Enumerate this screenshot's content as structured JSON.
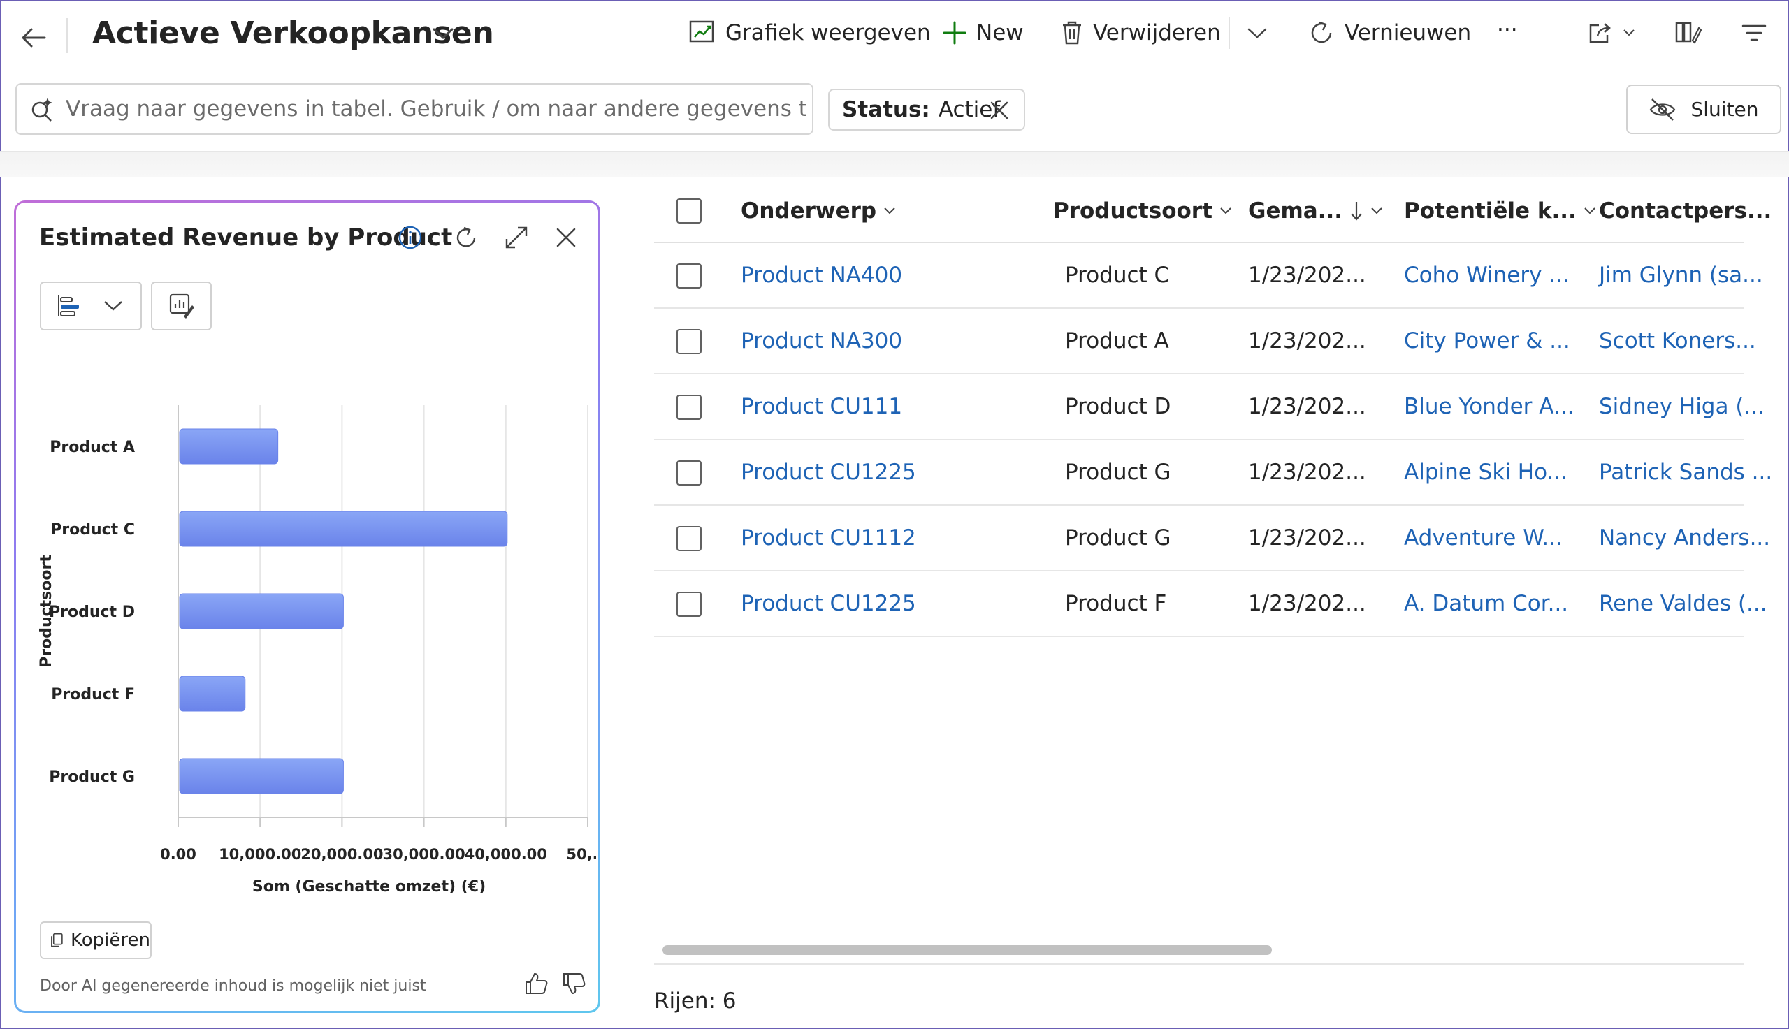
{
  "header": {
    "title": "Actieve Verkoopkansen",
    "commands": {
      "show_chart": "Grafiek weergeven",
      "new": "New",
      "delete": "Verwijderen",
      "refresh": "Vernieuwen",
      "more": "···"
    }
  },
  "search": {
    "placeholder": "Vraag naar gegevens in tabel. Gebruik / om naar andere gegevens te verwijzen"
  },
  "filter": {
    "key": "Status:",
    "value": "Actief"
  },
  "close_button": "Sluiten",
  "chart_card": {
    "title": "Estimated Revenue by Product",
    "copy_label": "Kopiëren",
    "disclaimer": "Door AI gegenereerde inhoud is mogelijk niet juist"
  },
  "chart_data": {
    "type": "bar",
    "orientation": "horizontal",
    "title": "Estimated Revenue by Product",
    "categories": [
      "Product A",
      "Product C",
      "Product D",
      "Product F",
      "Product G"
    ],
    "values": [
      12000,
      40000,
      20000,
      8000,
      20000
    ],
    "xlabel": "Som (Geschatte omzet) (€)",
    "ylabel": "Productsoort",
    "xlim": [
      0,
      50000
    ],
    "x_tick_labels": [
      "0.00",
      "10,000.00",
      "20,000.00",
      "30,000.00",
      "40,000.00",
      "50,..."
    ],
    "grid": true,
    "bar_color": "#7b94f0"
  },
  "table": {
    "columns": [
      "Onderwerp",
      "Productsoort",
      "Gema...",
      "Potentiële k...",
      "Contactpers..."
    ],
    "rows": [
      [
        "Product NA400",
        "Product C",
        "1/23/202...",
        "Coho Winery ...",
        "Jim Glynn (sa..."
      ],
      [
        "Product NA300",
        "Product A",
        "1/23/202...",
        "City Power & ...",
        "Scott Koners..."
      ],
      [
        "Product CU111",
        "Product D",
        "1/23/202...",
        "Blue Yonder A...",
        "Sidney Higa (..."
      ],
      [
        "Product CU1225",
        "Product G",
        "1/23/202...",
        "Alpine Ski Ho...",
        "Patrick Sands ..."
      ],
      [
        "Product CU1112",
        "Product G",
        "1/23/202...",
        "Adventure W...",
        "Nancy Anders..."
      ],
      [
        "Product CU1225",
        "Product F",
        "1/23/202...",
        "A. Datum Cor...",
        "Rene Valdes (..."
      ]
    ],
    "row_count_label": "Rijen: 6"
  },
  "colors": {
    "accent": "#1e63b5",
    "new_icon": "#107c10",
    "frame": "#6b5fb5"
  }
}
